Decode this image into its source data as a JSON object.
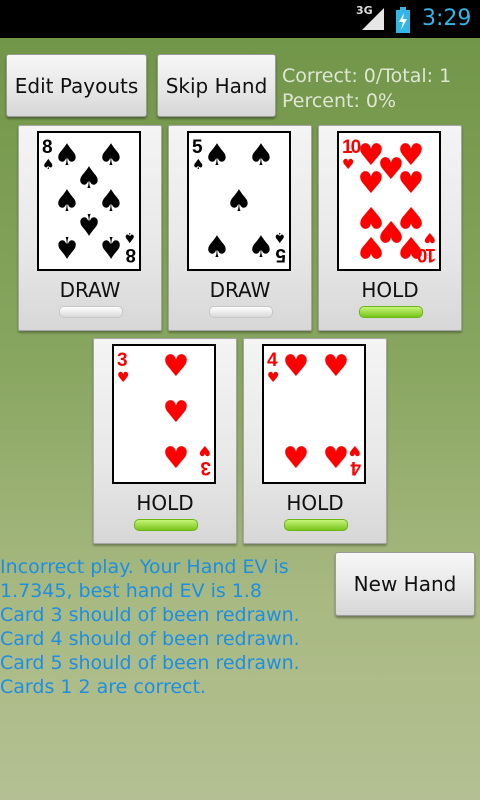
{
  "status_bar": {
    "network": "3G",
    "time": "3:29",
    "clock_color": "#33b5e5"
  },
  "buttons": {
    "edit_payouts": "Edit Payouts",
    "skip_hand": "Skip Hand",
    "new_hand": "New Hand"
  },
  "stats": {
    "correct_total": "Correct: 0/Total: 1",
    "percent": "Percent: 0%"
  },
  "cards": [
    {
      "rank": "8",
      "suit": "spades",
      "suit_symbol": "♠",
      "color": "#000000",
      "action": "DRAW",
      "held": false
    },
    {
      "rank": "5",
      "suit": "spades",
      "suit_symbol": "♠",
      "color": "#000000",
      "action": "DRAW",
      "held": false
    },
    {
      "rank": "10",
      "suit": "hearts",
      "suit_symbol": "♥",
      "color": "#ff0000",
      "action": "HOLD",
      "held": true
    },
    {
      "rank": "3",
      "suit": "hearts",
      "suit_symbol": "♥",
      "color": "#ff0000",
      "action": "HOLD",
      "held": true
    },
    {
      "rank": "4",
      "suit": "hearts",
      "suit_symbol": "♥",
      "color": "#ff0000",
      "action": "HOLD",
      "held": true
    }
  ],
  "message": {
    "lines": [
      "Incorrect play.  Your Hand EV is",
      "1.7345, best hand EV is 1.8",
      "Card 3 should of been redrawn.",
      "Card 4 should of been redrawn.",
      "Card 5 should of been redrawn.",
      "Cards 1 2 are correct."
    ],
    "color": "#1e8fe0"
  },
  "colors": {
    "background_top": "#6f9446",
    "background_bottom": "#b4c093",
    "held_indicator": "#79c51b"
  }
}
